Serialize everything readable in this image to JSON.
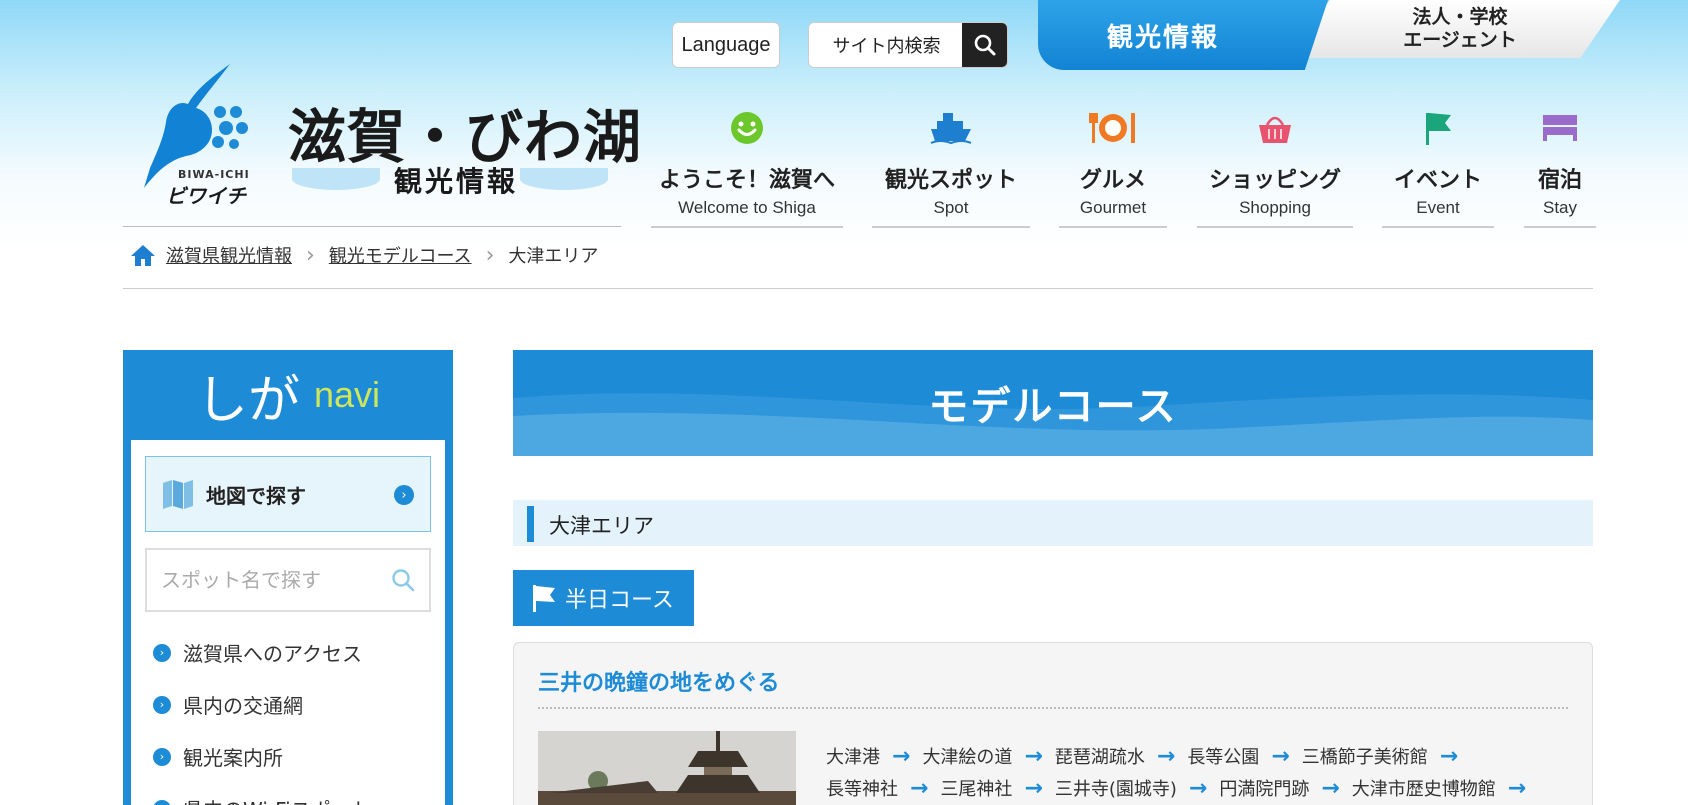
{
  "header": {
    "logo": {
      "main": "滋賀・びわ湖",
      "sub": "観光情報",
      "mascot_en": "BIWA-ICHI",
      "mascot_kana": "ビワイチ"
    },
    "language_label": "Language",
    "site_search_label": "サイト内検索",
    "tab_tourism": "観光情報",
    "tab_corporate_line1": "法人・学校",
    "tab_corporate_line2": "エージェント"
  },
  "nav": [
    {
      "jp": "ようこそ！滋賀へ",
      "en": "Welcome to Shiga",
      "icon": "smiley-icon"
    },
    {
      "jp": "観光スポット",
      "en": "Spot",
      "icon": "ship-icon"
    },
    {
      "jp": "グルメ",
      "en": "Gourmet",
      "icon": "plate-icon"
    },
    {
      "jp": "ショッピング",
      "en": "Shopping",
      "icon": "basket-icon"
    },
    {
      "jp": "イベント",
      "en": "Event",
      "icon": "flag-icon"
    },
    {
      "jp": "宿泊",
      "en": "Stay",
      "icon": "bed-icon"
    }
  ],
  "breadcrumb": {
    "home": "滋賀県観光情報",
    "level2": "観光モデルコース",
    "current": "大津エリア"
  },
  "sidebar": {
    "title_jp": "しが",
    "title_en": "navi",
    "map_search": "地図で探す",
    "spot_search_placeholder": "スポット名で探す",
    "links": [
      "滋賀県へのアクセス",
      "県内の交通網",
      "観光案内所",
      "県内のWi-Fiスポット"
    ]
  },
  "main": {
    "hero_title": "モデルコース",
    "area": "大津エリア",
    "course_tag": "半日コース",
    "course_title": "三井の晩鐘の地をめぐる",
    "route_line1": [
      "大津港",
      "大津絵の道",
      "琵琶湖疏水",
      "長等公園",
      "三橋節子美術館"
    ],
    "route_line2": [
      "長等神社",
      "三尾神社",
      "三井寺(園城寺)",
      "円満院門跡",
      "大津市歴史博物館"
    ]
  },
  "colors": {
    "brand_blue": "#1e8bd6",
    "navi_green": "#cde65a",
    "area_bg": "#e3f2fb"
  }
}
